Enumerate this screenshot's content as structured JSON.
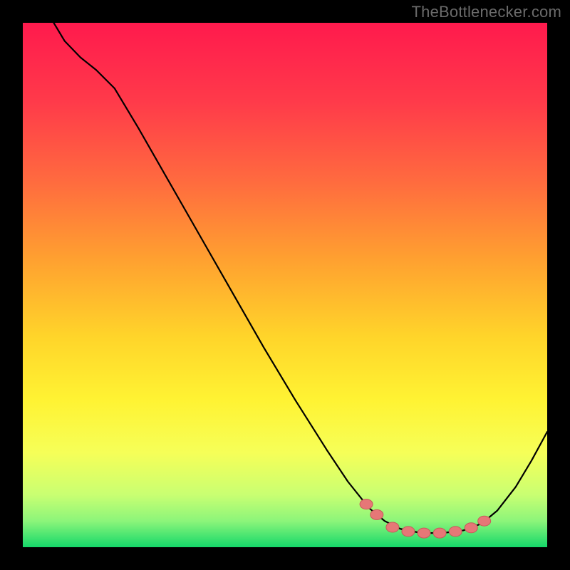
{
  "watermark": {
    "text": "TheBottlenecker.com"
  },
  "chart_data": {
    "type": "line",
    "title": "",
    "xlabel": "",
    "ylabel": "",
    "xlim": [
      0,
      100
    ],
    "ylim": [
      0,
      100
    ],
    "plot_background_gradient": {
      "top_color": "#ff1a4d",
      "middle_color": "#ffe536",
      "bottom_color": "#15d86a"
    },
    "frame_color": "#000000",
    "curve_color": "#000000",
    "marker_color": "#e67777",
    "marker_edge_color": "#c85a5a",
    "curve_points": [
      {
        "x": 5.9,
        "y": 100.0
      },
      {
        "x": 8.0,
        "y": 96.5
      },
      {
        "x": 11.0,
        "y": 93.4
      },
      {
        "x": 14.0,
        "y": 91.0
      },
      {
        "x": 17.5,
        "y": 87.5
      },
      {
        "x": 22.0,
        "y": 80.0
      },
      {
        "x": 28.0,
        "y": 69.5
      },
      {
        "x": 34.0,
        "y": 59.0
      },
      {
        "x": 40.0,
        "y": 48.5
      },
      {
        "x": 46.0,
        "y": 38.0
      },
      {
        "x": 52.0,
        "y": 28.0
      },
      {
        "x": 58.0,
        "y": 18.5
      },
      {
        "x": 62.0,
        "y": 12.5
      },
      {
        "x": 66.0,
        "y": 7.5
      },
      {
        "x": 69.0,
        "y": 5.0
      },
      {
        "x": 72.0,
        "y": 3.5
      },
      {
        "x": 76.0,
        "y": 2.7
      },
      {
        "x": 80.0,
        "y": 2.7
      },
      {
        "x": 84.0,
        "y": 3.2
      },
      {
        "x": 87.5,
        "y": 4.5
      },
      {
        "x": 90.5,
        "y": 7.0
      },
      {
        "x": 94.0,
        "y": 11.5
      },
      {
        "x": 97.0,
        "y": 16.5
      },
      {
        "x": 100.0,
        "y": 22.0
      }
    ],
    "markers": [
      {
        "x": 65.5,
        "y": 8.2
      },
      {
        "x": 67.5,
        "y": 6.2
      },
      {
        "x": 70.5,
        "y": 3.8
      },
      {
        "x": 73.5,
        "y": 3.0
      },
      {
        "x": 76.5,
        "y": 2.7
      },
      {
        "x": 79.5,
        "y": 2.7
      },
      {
        "x": 82.5,
        "y": 3.0
      },
      {
        "x": 85.5,
        "y": 3.7
      },
      {
        "x": 88.0,
        "y": 5.0
      }
    ]
  }
}
